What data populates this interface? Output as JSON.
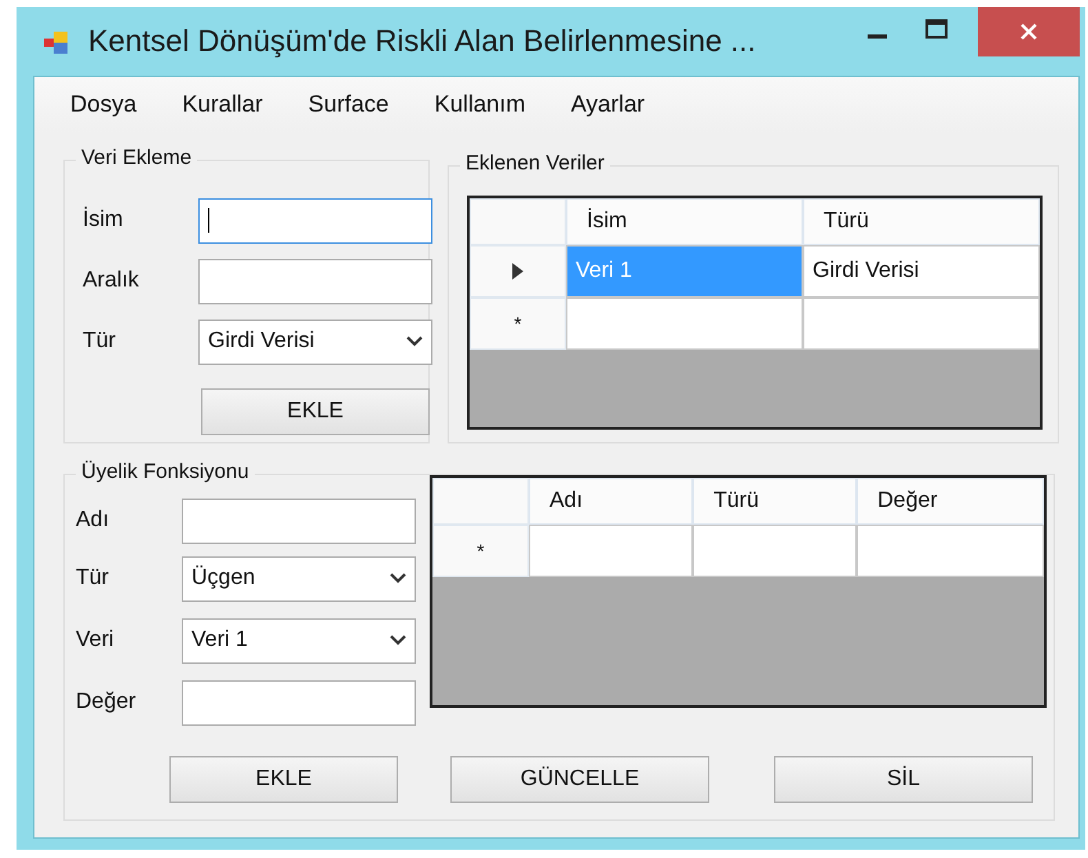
{
  "window": {
    "title": "Kentsel Dönüşüm'de Riskli Alan Belirlenmesine ..."
  },
  "menu": [
    "Dosya",
    "Kurallar",
    "Surface",
    "Kullanım",
    "Ayarlar"
  ],
  "veri_ekleme": {
    "title": "Veri Ekleme",
    "fields": [
      {
        "label": "İsim",
        "kind": "text",
        "focused": true
      },
      {
        "label": "Aralık",
        "kind": "text",
        "focused": false
      },
      {
        "label": "Tür",
        "kind": "dropdown",
        "value": "Girdi Verisi"
      }
    ],
    "button": "EKLE"
  },
  "eklenen_veriler": {
    "title": "Eklenen Veriler",
    "columns": [
      "İsim",
      "Türü"
    ],
    "rows": [
      {
        "kind": "data",
        "current": true,
        "cells": [
          {
            "text": "Veri 1",
            "selected": true
          },
          {
            "text": "Girdi Verisi",
            "selected": false
          }
        ]
      },
      {
        "kind": "new",
        "header": "*"
      }
    ]
  },
  "uyelik_fonksiyonu": {
    "title": "Üyelik Fonksiyonu",
    "fields": [
      {
        "label": "Adı",
        "kind": "text",
        "focused": false
      },
      {
        "label": "Tür",
        "kind": "dropdown",
        "value": "Üçgen"
      },
      {
        "label": "Veri",
        "kind": "dropdown",
        "value": "Veri 1"
      },
      {
        "label": "Değer",
        "kind": "text",
        "focused": false
      }
    ],
    "columns": [
      "Adı",
      "Türü",
      "Değer"
    ],
    "rows": [
      {
        "kind": "new",
        "header": "*"
      }
    ],
    "buttons": [
      "EKLE",
      "GÜNCELLE",
      "SİL"
    ]
  }
}
